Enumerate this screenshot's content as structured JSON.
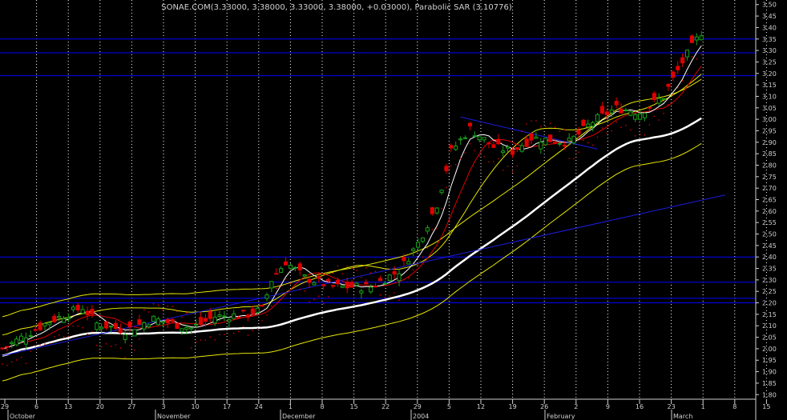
{
  "chart_data": {
    "type": "candlestick",
    "title": "SONAE.COM(3.33000, 3.38000, 3.33000, 3.38000, +0.03000), Parabolic SAR (3.10776)",
    "ylim": [
      1.78,
      3.52
    ],
    "y_ticks": [
      1.8,
      1.85,
      1.9,
      1.95,
      2.0,
      2.05,
      2.1,
      2.15,
      2.2,
      2.25,
      2.3,
      2.35,
      2.4,
      2.45,
      2.5,
      2.55,
      2.6,
      2.65,
      2.7,
      2.75,
      2.8,
      2.85,
      2.9,
      2.95,
      3.0,
      3.05,
      3.1,
      3.15,
      3.2,
      3.25,
      3.3,
      3.35,
      3.4,
      3.45,
      3.5
    ],
    "y_tick_labels": [
      "1.80",
      "1.85",
      "1.90",
      "1.95",
      "2.00",
      "2.05",
      "2.10",
      "2.15",
      "2.20",
      "2.25",
      "2.30",
      "2.35",
      "2.40",
      "2.45",
      "2.50",
      "2.55",
      "2.60",
      "2.65",
      "2.70",
      "2.75",
      "2.80",
      "2.85",
      "2.90",
      "2.95",
      "3.00",
      "3.05",
      "3.10",
      "3.15",
      "3.20",
      "3.25",
      "3.30",
      "3.35",
      "3.40",
      "3.45",
      "3.50"
    ],
    "x_tick_labels": [
      "29",
      "6",
      "13",
      "20",
      "27",
      "3",
      "10",
      "17",
      "24",
      "1",
      "8",
      "15",
      "22",
      "29",
      "5",
      "12",
      "19",
      "26",
      "2",
      "9",
      "16",
      "23",
      "1",
      "8",
      "15"
    ],
    "month_labels": [
      "October",
      "November",
      "December",
      "2004",
      "February",
      "March"
    ],
    "horizontal_levels": [
      3.35,
      3.29,
      3.19,
      2.4,
      2.29,
      2.22,
      2.2
    ],
    "trendline": {
      "start": [
        0,
        1.97
      ],
      "end": [
        153,
        2.67
      ]
    },
    "channel_line": {
      "start": [
        97,
        3.01
      ],
      "end": [
        126,
        2.87
      ]
    },
    "colors": {
      "up": "#19a019",
      "down": "#e00000",
      "ma_white": "#ffffff",
      "ma_red": "#e00000",
      "ma_yellow": "#e6e600",
      "levels": "#0000ff",
      "grid": "#ffffff",
      "trend": "#1c1ce0"
    }
  }
}
